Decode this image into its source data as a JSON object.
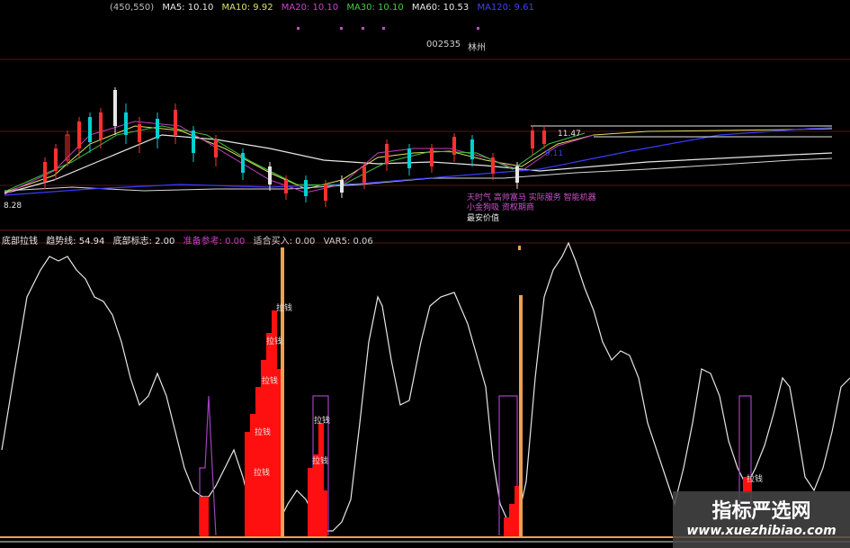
{
  "top_legend": {
    "range": "(450,550)",
    "ma5": "MA5: 10.10",
    "ma10": "MA10: 9.92",
    "ma20": "MA20: 10.10",
    "ma30": "MA30: 10.10",
    "ma60": "MA60: 10.53",
    "extra": "MA120: 9.61"
  },
  "stock_code": "002535",
  "stock_code_suffix": "林州",
  "price_left_label": "8.28",
  "price_right_label": "11.47",
  "price_right_label2": "9.11",
  "annotations": {
    "a1": "天时气  高帅富马  实际服务  智能机器",
    "a2": "小金狗吸  资权期商",
    "a3": "最安价值"
  },
  "mid_legend": {
    "name": "底部拉钱",
    "trend": "趋势线: 54.94",
    "bottom": "底部标志: 2.00",
    "prepare": "准备参考: 0.00",
    "buy": "适合买入: 0.00",
    "var5": "VAR5: 0.06"
  },
  "signal_label": "拉钱",
  "watermark": {
    "cn": "指标严选网",
    "url": "www.xuezhibiao.com"
  },
  "colors": {
    "background": "#000000",
    "white_line": "#e6e6e6",
    "red_bar": "#ff1010",
    "orange": "#f0a050",
    "purple": "#a040c0",
    "ma_blue": "#3a3aff",
    "ma_yellow": "#e0e060"
  }
}
